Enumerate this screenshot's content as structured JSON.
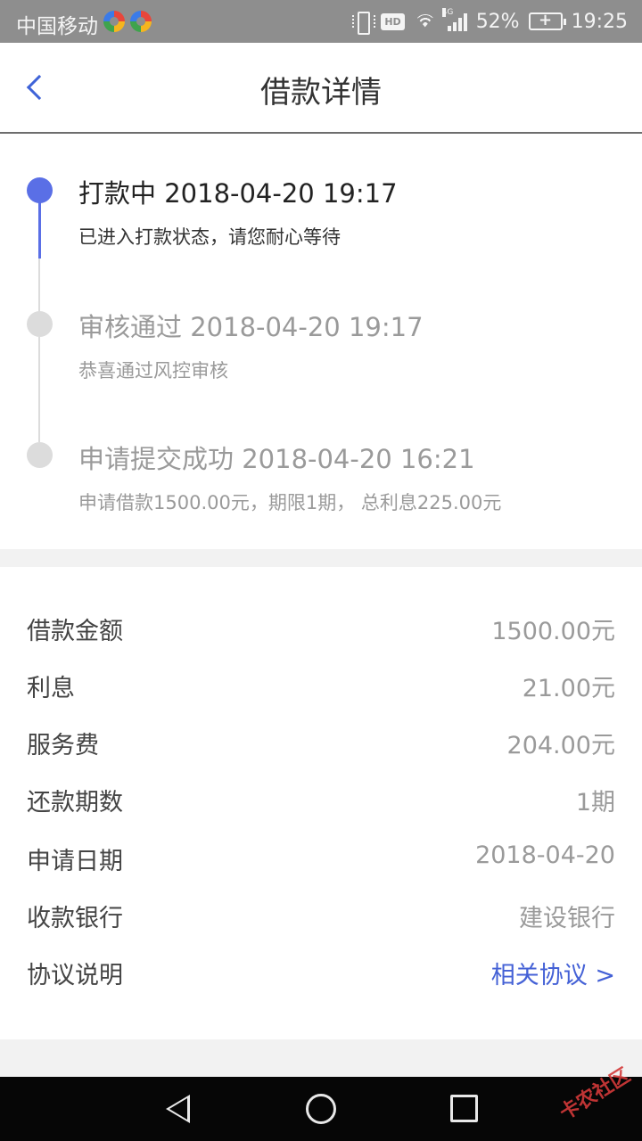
{
  "status_bar": {
    "carrier": "中国移动",
    "network": "4G",
    "hd": "HD",
    "battery_percent": "52%",
    "time": "19:25"
  },
  "header": {
    "title": "借款详情"
  },
  "timeline": [
    {
      "title": "打款中 2018-04-20 19:17",
      "desc": "已进入打款状态，请您耐心等待",
      "active": true
    },
    {
      "title": "审核通过 2018-04-20 19:17",
      "desc": "恭喜通过风控审核",
      "active": false
    },
    {
      "title": "申请提交成功 2018-04-20 16:21",
      "desc": "申请借款1500.00元，期限1期， 总利息225.00元",
      "active": false
    }
  ],
  "details": [
    {
      "label": "借款金额",
      "value": "1500.00元"
    },
    {
      "label": "利息",
      "value": "21.00元"
    },
    {
      "label": "服务费",
      "value": "204.00元"
    },
    {
      "label": "还款期数",
      "value": "1期"
    },
    {
      "label": "申请日期",
      "value": "2018-04-20"
    },
    {
      "label": "收款银行",
      "value": "建设银行"
    },
    {
      "label": "协议说明",
      "value": "相关协议 >"
    }
  ],
  "watermark": "卡农社区",
  "colors": {
    "accent": "#5a6fe6",
    "link": "#4461d6",
    "status_bar": "#8e8e8e"
  }
}
